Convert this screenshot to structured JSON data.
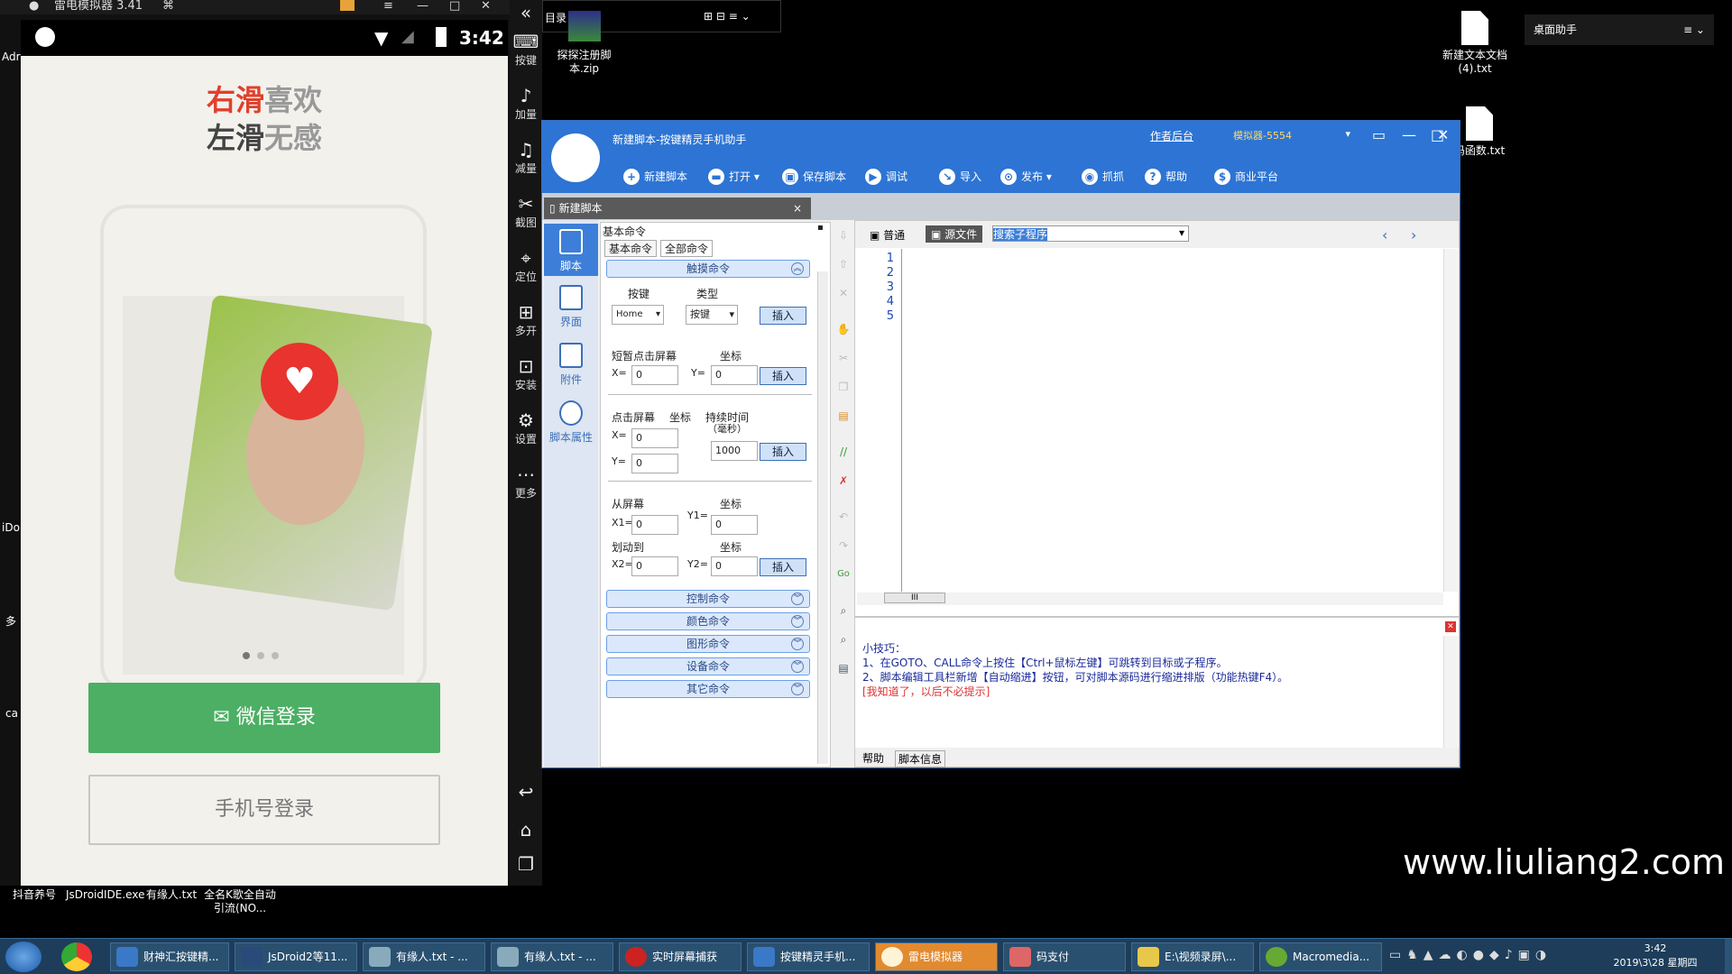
{
  "emulator": {
    "title": "雷电模拟器 3.41",
    "time": "3:42",
    "promo_line1_accent": "右滑",
    "promo_line1_rest": "喜欢",
    "promo_line2_accent": "左滑",
    "promo_line2_rest": "无感",
    "wechat_login": "微信登录",
    "phone_login": "手机号登录",
    "side": [
      "按键",
      "加量",
      "减量",
      "截图",
      "定位",
      "多开",
      "安装",
      "设置",
      "更多"
    ]
  },
  "desktop": {
    "dir_label": "目录",
    "zip_label": "探探注册脚本.zip",
    "txt1_label": "新建文本文档(4).txt",
    "txt2_label": "码函数.txt",
    "widget_label": "桌面助手",
    "left_icons": [
      "抖音养号",
      "JsDroidIDE.exe",
      "有缘人.txt",
      "全名K歌全自动引流(NO..."
    ],
    "left_edge": [
      "Adr",
      "iDo",
      "多",
      "ca"
    ],
    "watermark": "www.liuliang2.com"
  },
  "editor": {
    "title": "新建脚本-按键精灵手机助手",
    "author_link": "作者后台",
    "emulator_select": "模拟器-5554",
    "toolbar": [
      "新建脚本",
      "打开",
      "保存脚本",
      "调试",
      "导入",
      "发布",
      "抓抓",
      "帮助",
      "商业平台"
    ],
    "tab_label": "新建脚本",
    "left_nav": [
      "脚本",
      "界面",
      "附件",
      "脚本属性"
    ],
    "cmd_panel_title": "基本命令",
    "cmd_tabs": [
      "基本命令",
      "全部命令"
    ],
    "group_touch": "触摸命令",
    "key_label": "按键",
    "type_label": "类型",
    "key_value": "Home",
    "type_value": "按键",
    "insert": "插入",
    "short_click": "短暂点击屏幕",
    "coord": "坐标",
    "x_eq": "X=",
    "y_eq": "Y=",
    "zero": "0",
    "click_screen": "点击屏幕",
    "duration": "持续时间",
    "duration_unit": "（毫秒）",
    "duration_value": "1000",
    "from_screen": "从屏幕",
    "slide_to": "划动到",
    "x1": "X1=",
    "y1": "Y1=",
    "x2": "X2=",
    "y2": "Y2=",
    "groups": [
      "控制命令",
      "颜色命令",
      "图形命令",
      "设备命令",
      "其它命令"
    ],
    "view_normal": "普通",
    "view_source": "源文件",
    "search_sub": "搜索子程序",
    "line_numbers": [
      "1",
      "2",
      "3",
      "4",
      "5"
    ],
    "scroll_mark": "III",
    "tips_title": "小技巧：",
    "tip1": "1、在GOTO、CALL命令上按住【Ctrl+鼠标左键】可跳转到目标或子程序。",
    "tip2": "2、脚本编辑工具栏新增【自动缩进】按钮，可对脚本源码进行缩进排版（功能热键F4）。",
    "tip3": "[我知道了，以后不必提示]",
    "bottom_tabs": [
      "帮助",
      "脚本信息"
    ]
  },
  "taskbar": {
    "items": [
      "财神汇按键精...",
      "JsDroid2等11...",
      "有缘人.txt - ...",
      "有缘人.txt - ...",
      "实时屏幕捕获",
      "按键精灵手机...",
      "雷电模拟器",
      "码支付",
      "E:\\视频录屏\\...",
      "Macromedia..."
    ],
    "time": "3:42",
    "date": "2019\\3\\28 星期四"
  }
}
